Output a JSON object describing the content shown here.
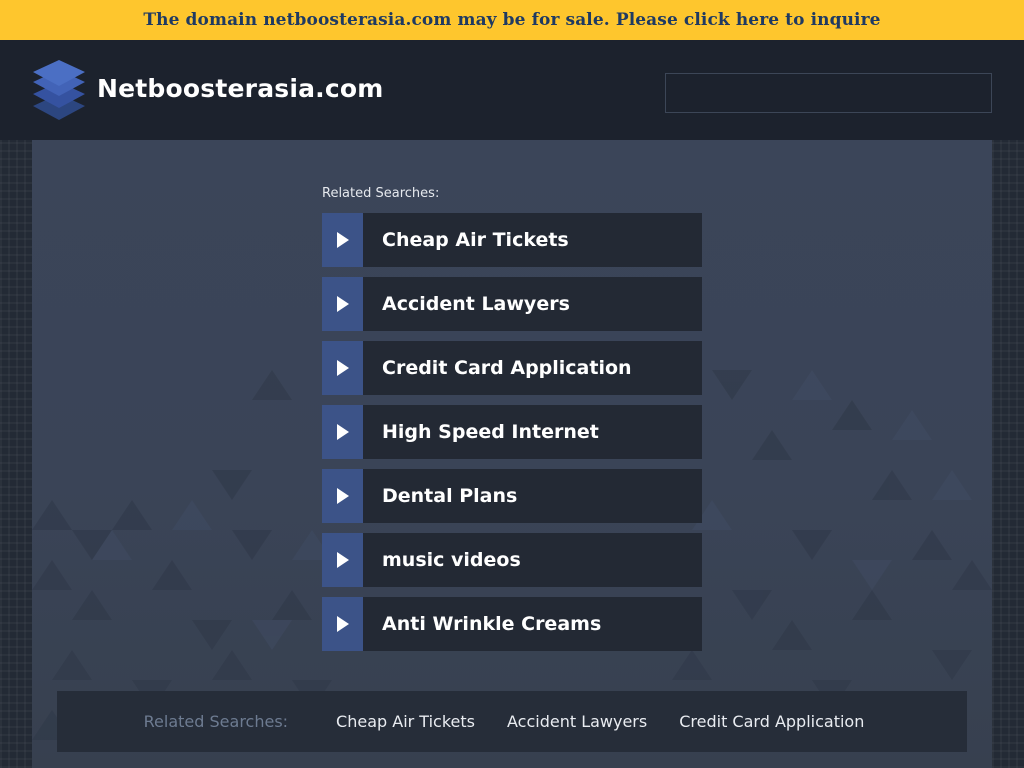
{
  "banner": {
    "text": "The domain netboosterasia.com may be for sale. Please click here to inquire",
    "background": "#fec62d",
    "text_color": "#1f3a62"
  },
  "header": {
    "site_name": "Netboosterasia.com",
    "logo_icon": "stacked-layers-icon",
    "search": {
      "value": "",
      "placeholder": ""
    }
  },
  "main": {
    "related_label": "Related Searches:",
    "items": [
      {
        "label": "Cheap Air Tickets",
        "icon": "play-arrow-icon"
      },
      {
        "label": "Accident Lawyers",
        "icon": "play-arrow-icon"
      },
      {
        "label": "Credit Card Application",
        "icon": "play-arrow-icon"
      },
      {
        "label": "High Speed Internet",
        "icon": "play-arrow-icon"
      },
      {
        "label": "Dental Plans",
        "icon": "play-arrow-icon"
      },
      {
        "label": "music videos",
        "icon": "play-arrow-icon"
      },
      {
        "label": "Anti Wrinkle Creams",
        "icon": "play-arrow-icon"
      }
    ],
    "accent_color": "#3c5388"
  },
  "footer": {
    "label": "Related Searches:",
    "links": [
      "Cheap Air Tickets",
      "Accident Lawyers",
      "Credit Card Application"
    ]
  }
}
